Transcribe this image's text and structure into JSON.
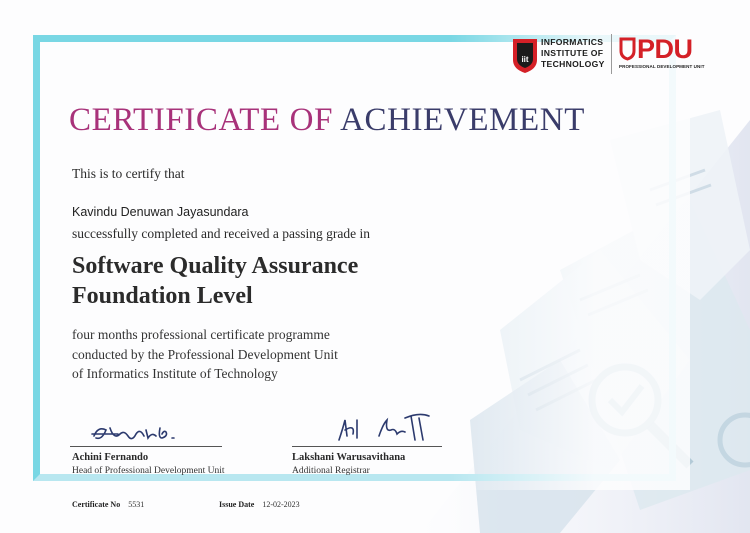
{
  "logos": {
    "iit_lines": [
      "INFORMATICS",
      "INSTITUTE OF",
      "TECHNOLOGY"
    ],
    "iit_emblem_text": "iit",
    "pdu": "PDU",
    "pdu_subtitle": "PROFESSIONAL DEVELOPMENT UNIT"
  },
  "title_part1": "CERTIFICATE OF",
  "title_part2": "ACHIEVEMENT",
  "certify_text": "This is to certify that",
  "recipient_name": "Kavindu Denuwan Jayasundara",
  "completed_text": "successfully completed and received a passing grade in",
  "course_line1": "Software Quality Assurance",
  "course_line2": "Foundation Level",
  "description_lines": [
    "four months professional certificate programme",
    "conducted by the Professional Development Unit",
    "of Informatics Institute of Technology"
  ],
  "signatories": [
    {
      "name": "Achini Fernando",
      "title": "Head of Professional Development Unit"
    },
    {
      "name": "Lakshani Warusavithana",
      "title": "Additional Registrar"
    }
  ],
  "certificate_no_label": "Certificate No",
  "certificate_no": "5531",
  "issue_date_label": "Issue Date",
  "issue_date": "12-02-2023",
  "colors": {
    "frame": "#79d7e4",
    "title_magenta": "#a8327a",
    "title_navy": "#3a3c6a",
    "brand_red": "#d42027"
  }
}
